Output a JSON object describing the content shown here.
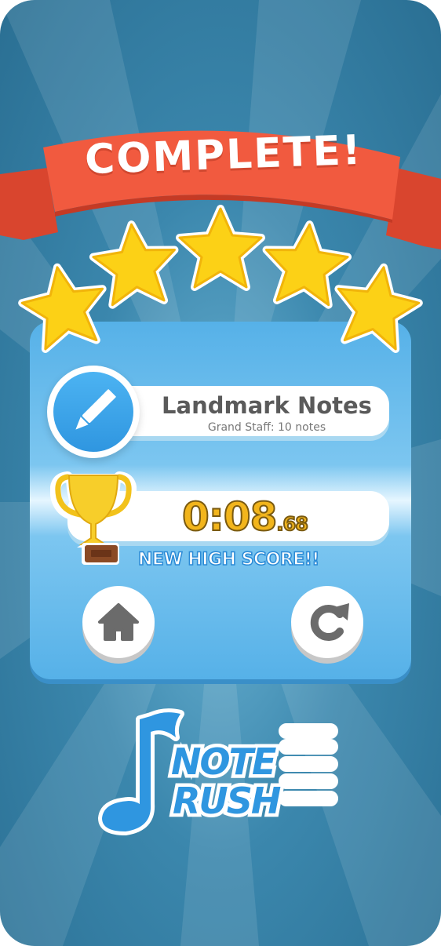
{
  "banner": {
    "text": "COMPLETE!"
  },
  "rating": {
    "stars": 5,
    "max_stars": 5
  },
  "level": {
    "title": "Landmark Notes",
    "subtitle": "Grand Staff: 10 notes",
    "icon": "pencil-icon"
  },
  "score": {
    "time_main": "0:08",
    "time_fraction": ".68",
    "label": "NEW HIGH SCORE!!",
    "icon": "trophy-icon"
  },
  "buttons": {
    "home_icon": "home-icon",
    "retry_icon": "retry-icon"
  },
  "logo": {
    "line1": "NOTE",
    "line2": "RUSH"
  },
  "colors": {
    "banner": "#f15a3f",
    "star": "#fcd116",
    "panel": "#56b1e8",
    "accent_blue": "#2f96e0",
    "gold": "#f2b51c"
  }
}
